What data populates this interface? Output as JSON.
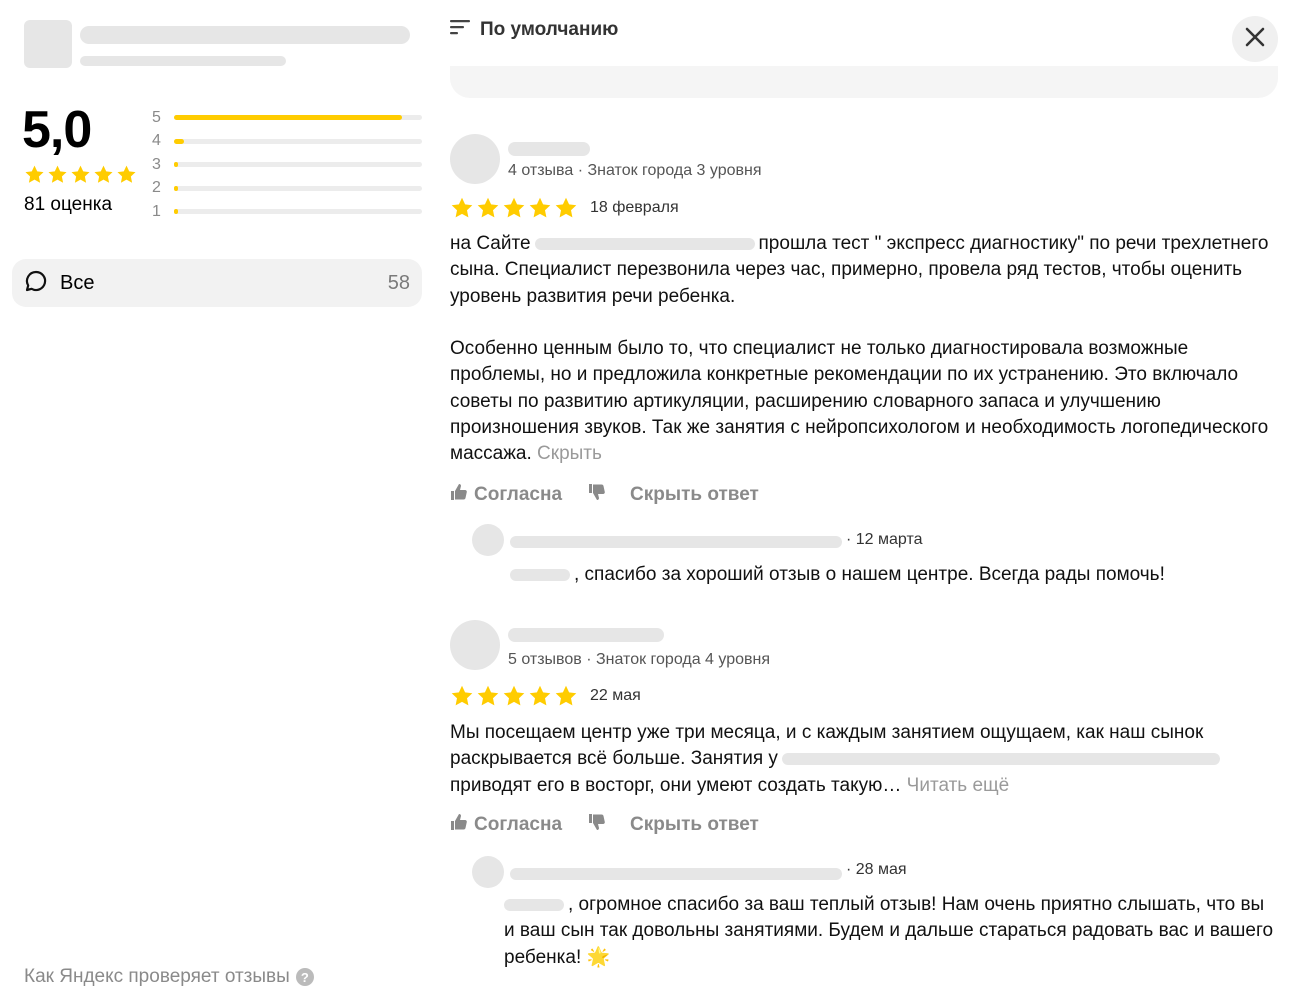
{
  "summary": {
    "rating": "5,0",
    "count_label": "81 оценка",
    "distribution": [
      {
        "label": "5",
        "fraction": 0.92
      },
      {
        "label": "4",
        "fraction": 0.04
      },
      {
        "label": "3",
        "fraction": 0.0
      },
      {
        "label": "2",
        "fraction": 0.01
      },
      {
        "label": "1",
        "fraction": 0.01
      }
    ]
  },
  "filter": {
    "label": "Все",
    "count": "58"
  },
  "footer": {
    "how_check": "Как Яндекс проверяет отзывы",
    "help_glyph": "?"
  },
  "sort": {
    "label": "По умолчанию"
  },
  "colors": {
    "star": "#ffcc00",
    "muted": "#8a8a8a"
  },
  "reviews": [
    {
      "meta": "4 отзыва · Знаток города 3 уровня",
      "stars": 5,
      "date": "18 февраля",
      "text_p1_a": "на Сайте",
      "text_p1_b": "прошла тест \" экспресс диагностику\" по речи трехлетнего сына. Специалист перезвонила через час, примерно, провела ряд тестов, чтобы оценить уровень развития речи ребенка.",
      "text_p2": "Особенно ценным было то, что специалист не только диагностировала возможные проблемы, но и предложила конкретные рекомендации по их устранению. Это включало советы по развитию артикуляции, расширению словарного запаса и улучшению произношения звуков. Так же занятия с нейропсихологом и необходимость логопедического массажа.",
      "toggle_link": "Скрыть",
      "agree": "Согласна",
      "hide_reply": "Скрыть ответ",
      "reply": {
        "date": "· 12 марта",
        "text": ", спасибо за хороший отзыв о нашем центре. Всегда рады помочь!"
      }
    },
    {
      "meta": "5 отзывов · Знаток города 4 уровня",
      "stars": 5,
      "date": "22 мая",
      "text_a": "Мы посещаем центр уже три месяца, и с каждым занятием ощущаем, как наш сынок раскрывается всё больше. Занятия у",
      "text_b": "приводят его в восторг, они умеют создать такую…",
      "toggle_link": "Читать ещё",
      "agree": "Согласна",
      "hide_reply": "Скрыть ответ",
      "reply": {
        "date": "· 28 мая",
        "text": ", огромное спасибо за ваш теплый отзыв! Нам очень приятно слышать, что вы и ваш сын так довольны занятиями. Будем и дальше стараться радовать вас и вашего ребенка! 🌟"
      }
    }
  ]
}
